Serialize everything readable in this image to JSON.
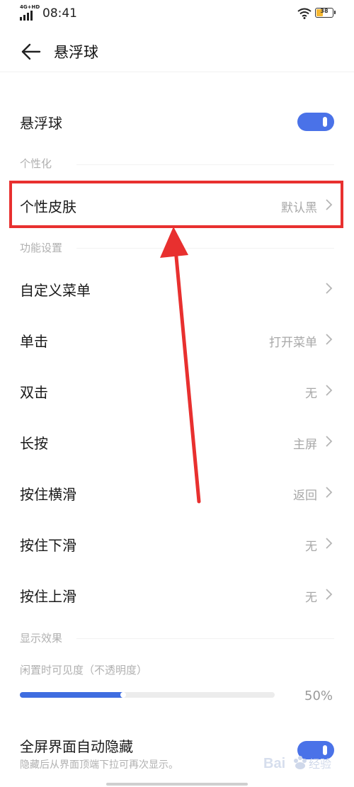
{
  "status_bar": {
    "network": "4G+HD",
    "time": "08:41",
    "battery": "38"
  },
  "header": {
    "back_icon": "arrow-left-icon",
    "title": "悬浮球"
  },
  "main": {
    "float_ball": {
      "label": "悬浮球",
      "enabled": true
    },
    "personalize_section": "个性化",
    "skin": {
      "label": "个性皮肤",
      "value": "默认黑"
    },
    "function_section": "功能设置",
    "custom_menu": {
      "label": "自定义菜单",
      "value": ""
    },
    "single_tap": {
      "label": "单击",
      "value": "打开菜单"
    },
    "double_tap": {
      "label": "双击",
      "value": "无"
    },
    "long_press": {
      "label": "长按",
      "value": "主屏"
    },
    "hold_swipe_horizontal": {
      "label": "按住横滑",
      "value": "返回"
    },
    "hold_swipe_down": {
      "label": "按住下滑",
      "value": "无"
    },
    "hold_swipe_up": {
      "label": "按住上滑",
      "value": "无"
    },
    "display_section": "显示效果",
    "idle_visibility": {
      "label": "闲置时可见度（不透明度）",
      "value_text": "50%",
      "fraction": 0.41
    },
    "fullscreen_hide": {
      "label": "全屏界面自动隐藏",
      "description": "隐藏后从界面顶端下拉可再次显示。",
      "enabled": true
    }
  },
  "colors": {
    "accent": "#4a72e8",
    "annotation_red": "#e8302f"
  },
  "watermark": "Bai经验"
}
